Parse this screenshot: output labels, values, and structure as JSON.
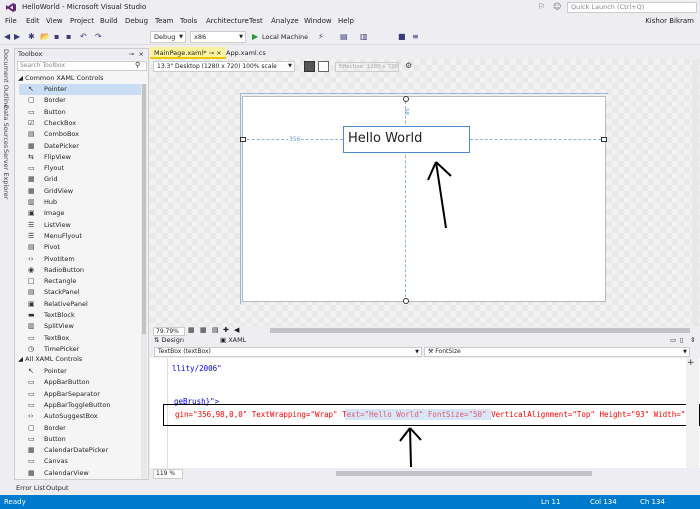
{
  "window": {
    "title": "HelloWorld - Microsoft Visual Studio",
    "quick_launch": "Quick Launch (Ctrl+Q)",
    "user": "Kishor Bikram"
  },
  "menu": [
    "File",
    "Edit",
    "View",
    "Project",
    "Build",
    "Debug",
    "Team",
    "Tools",
    "Architecture",
    "Test",
    "Analyze",
    "Window",
    "Help"
  ],
  "toolbar": {
    "config": "Debug",
    "platform": "x86",
    "run": "Local Machine"
  },
  "side_tabs": [
    "Document Outline",
    "Data Sources",
    "Server Explorer"
  ],
  "toolbox": {
    "title": "Toolbox",
    "search_placeholder": "Search Toolbox",
    "common_header": "Common XAML Controls",
    "common_items": [
      {
        "label": "Pointer",
        "icon": "↖"
      },
      {
        "label": "Border",
        "icon": "▢"
      },
      {
        "label": "Button",
        "icon": "▭"
      },
      {
        "label": "CheckBox",
        "icon": "☑"
      },
      {
        "label": "ComboBox",
        "icon": "▤"
      },
      {
        "label": "DatePicker",
        "icon": "▦"
      },
      {
        "label": "FlipView",
        "icon": "⇆"
      },
      {
        "label": "Flyout",
        "icon": "▭"
      },
      {
        "label": "Grid",
        "icon": "▦"
      },
      {
        "label": "GridView",
        "icon": "▦"
      },
      {
        "label": "Hub",
        "icon": "▥"
      },
      {
        "label": "Image",
        "icon": "▣"
      },
      {
        "label": "ListView",
        "icon": "☰"
      },
      {
        "label": "MenuFlyout",
        "icon": "☰"
      },
      {
        "label": "Pivot",
        "icon": "▤"
      },
      {
        "label": "PivotItem",
        "icon": "‹›"
      },
      {
        "label": "RadioButton",
        "icon": "◉"
      },
      {
        "label": "Rectangle",
        "icon": "□"
      },
      {
        "label": "StackPanel",
        "icon": "▤"
      },
      {
        "label": "RelativePanel",
        "icon": "▣"
      },
      {
        "label": "TextBlock",
        "icon": "▬"
      },
      {
        "label": "SplitView",
        "icon": "▥"
      },
      {
        "label": "TextBox",
        "icon": "▭"
      },
      {
        "label": "TimePicker",
        "icon": "◷"
      }
    ],
    "all_header": "All XAML Controls",
    "all_items": [
      {
        "label": "Pointer",
        "icon": "↖"
      },
      {
        "label": "AppBarButton",
        "icon": "▭"
      },
      {
        "label": "AppBarSeparator",
        "icon": "▭"
      },
      {
        "label": "AppBarToggleButton",
        "icon": "▭"
      },
      {
        "label": "AutoSuggestBox",
        "icon": "‹›"
      },
      {
        "label": "Border",
        "icon": "▢"
      },
      {
        "label": "Button",
        "icon": "▭"
      },
      {
        "label": "CalendarDatePicker",
        "icon": "▦"
      },
      {
        "label": "Canvas",
        "icon": "▭"
      },
      {
        "label": "CalendarView",
        "icon": "▦"
      }
    ]
  },
  "doc_tabs": [
    "MainPage.xaml*",
    "App.xaml.cs"
  ],
  "designer": {
    "device": "13.3\" Desktop (1280 x 720) 100% scale",
    "effective": "Effective: 1280 x 720",
    "textbox_text": "Hello World",
    "margin_left": "356",
    "margin_top": "98",
    "zoom": "79.79%"
  },
  "split_tabs": [
    "Design",
    "XAML"
  ],
  "editor": {
    "element_combo": "TextBox (textBox)",
    "property_combo": "FontSize",
    "line1": "llity/2006\"",
    "line2": "geBrush}\">",
    "line3": "gin=\"356,98,0,0\" TextWrapping=\"Wrap\" Text=\"Hello World\" FontSize=\"50\" VerticalAlignment=\"Top\" Height=\"93\" Width=\"",
    "zoom": "119 %"
  },
  "output_tabs": [
    "Error List",
    "Output"
  ],
  "status": {
    "text": "Ready",
    "line": "Ln 11",
    "col": "Col 134",
    "ch": "Ch 134"
  }
}
